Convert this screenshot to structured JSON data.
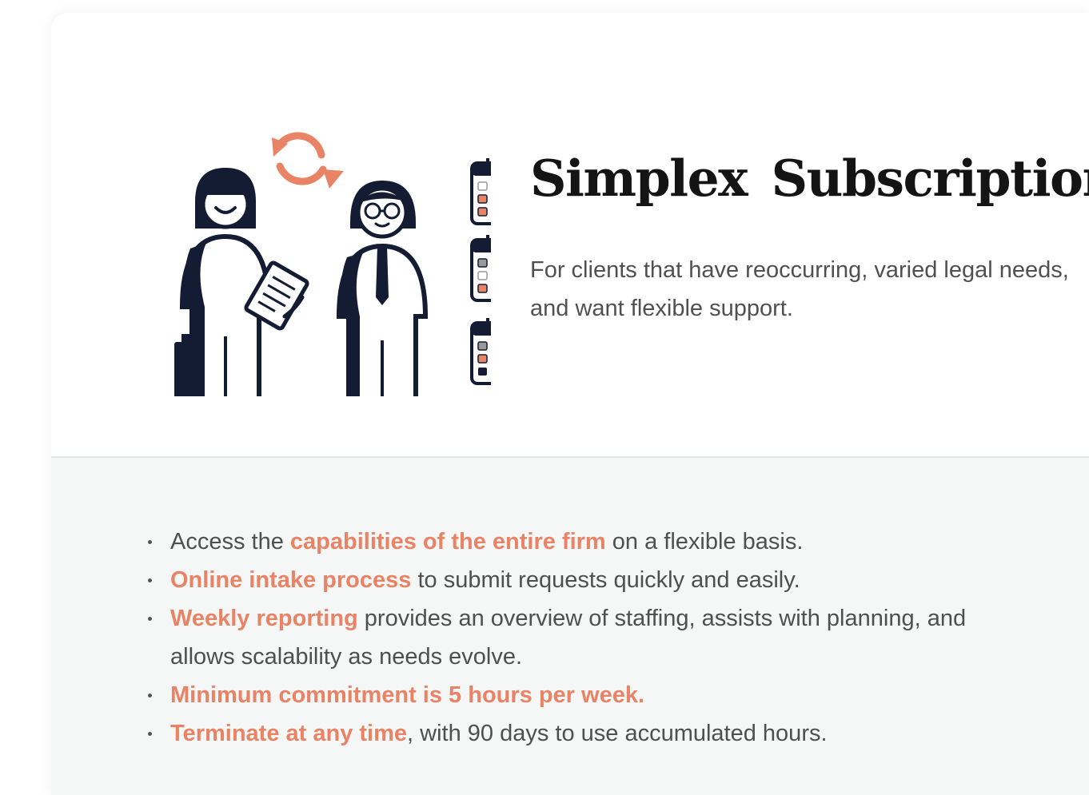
{
  "title": "Simplex Subscription",
  "subtitle": "For clients that have reoccurring, varied legal needs, and want flexible support.",
  "features": [
    {
      "before": "Access the ",
      "highlight": "capabilities of the entire firm",
      "after": " on a flexible basis."
    },
    {
      "before": "",
      "highlight": "Online intake process",
      "after": " to submit requests quickly and easily."
    },
    {
      "before": "",
      "highlight": "Weekly reporting",
      "after": " provides an overview of staffing, assists with planning, and allows scalability as needs evolve."
    },
    {
      "before": "",
      "highlight": "Minimum commitment is 5 hours per week.",
      "after": ""
    },
    {
      "before": "",
      "highlight": "Terminate at any time",
      "after": ", with 90 days to use accumulated hours."
    }
  ],
  "colors": {
    "accent": "#e98365",
    "navy": "#141c33",
    "text": "#4f4f4f",
    "title": "#141414",
    "bottom_bg": "#f5f6f6"
  },
  "icons": [
    "refresh-arrows-icon",
    "woman-figure-icon",
    "man-figure-icon",
    "document-icon",
    "suitcase-icon",
    "calendar-icon"
  ]
}
